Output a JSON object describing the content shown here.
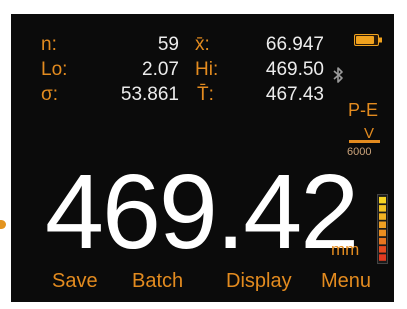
{
  "stats": {
    "n_label": "n:",
    "n_value": "59",
    "lo_label": "Lo:",
    "lo_value": "2.07",
    "sigma_label": "σ:",
    "sigma_value": "53.861",
    "mean_label": "x̄:",
    "mean_value": "66.947",
    "hi_label": "Hi:",
    "hi_value": "469.50",
    "tbar_label": "T̄:",
    "tbar_value": "467.43"
  },
  "reading": {
    "value": "469.42",
    "unit": "mm"
  },
  "probe": {
    "type": "P-E",
    "mode": "V",
    "number": "6000"
  },
  "softkeys": [
    "Save",
    "Batch",
    "Display",
    "Menu"
  ],
  "status": {
    "battery_level": 0.85,
    "signal_level": 1.0,
    "signal_colors": [
      "#e03a20",
      "#e54a1f",
      "#e8761f",
      "#eb8e20",
      "#ee9f22",
      "#f1b223",
      "#f3c323",
      "#f5d324"
    ],
    "accent_color": "#e38b1f",
    "battery_color": "#f0a21e",
    "bluetooth_icon": "bluetooth-icon",
    "battery_icon": "battery-icon"
  }
}
